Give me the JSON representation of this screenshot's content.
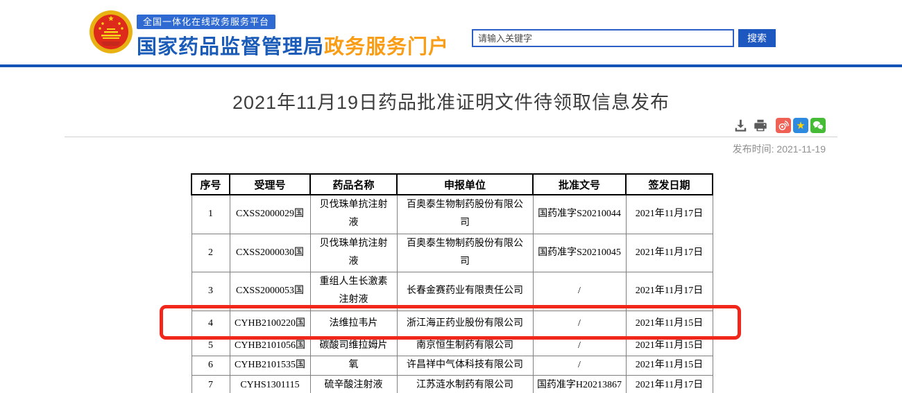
{
  "header": {
    "platform_badge": "全国一体化在线政务服务平台",
    "site_name": "国家药品监督管理局",
    "portal_name": "政务服务门户",
    "search": {
      "placeholder": "请输入关键字",
      "button_label": "搜索"
    }
  },
  "article": {
    "title": "2021年11月19日药品批准证明文件待领取信息发布",
    "publish_label": "发布时间:",
    "publish_date": "2021-11-19",
    "toolbar_icons": [
      "download-icon",
      "print-icon",
      "weibo-share-icon",
      "qzone-share-icon",
      "wechat-share-icon"
    ]
  },
  "table": {
    "headers": [
      "序号",
      "受理号",
      "药品名称",
      "申报单位",
      "批准文号",
      "签发日期"
    ],
    "rows": [
      [
        "1",
        "CXSS2000029国",
        "贝伐珠单抗注射液",
        "百奥泰生物制药股份有限公司",
        "国药准字S20210044",
        "2021年11月17日"
      ],
      [
        "2",
        "CXSS2000030国",
        "贝伐珠单抗注射液",
        "百奥泰生物制药股份有限公司",
        "国药准字S20210045",
        "2021年11月17日"
      ],
      [
        "3",
        "CXSS2000053国",
        "重组人生长激素注射液",
        "长春金赛药业有限责任公司",
        "/",
        "2021年11月17日"
      ],
      [
        "4",
        "CYHB2100220国",
        "法维拉韦片",
        "浙江海正药业股份有限公司",
        "/",
        "2021年11月15日"
      ],
      [
        "5",
        "CYHB2101056国",
        "碳酸司维拉姆片",
        "南京恒生制药有限公司",
        "/",
        "2021年11月15日"
      ],
      [
        "6",
        "CYHB2101535国",
        "氧",
        "许昌祥中气体科技有限公司",
        "/",
        "2021年11月15日"
      ],
      [
        "7",
        "CYHS1301115",
        "硫辛酸注射液",
        "江苏涟水制药有限公司",
        "国药准字H20213867",
        "2021年11月17日"
      ]
    ],
    "highlighted_row": "4"
  },
  "colors": {
    "brand_blue": "#1b5cb8",
    "brand_orange": "#fa9d16",
    "header_rule_blue": "#1553b7",
    "badge_blue": "#2e6ad1",
    "search_button_blue": "#1d57c0",
    "highlight_red": "#f2271c",
    "weibo_red": "#ef6055",
    "qzone_blue": "#2c8ae0",
    "wechat_green": "#46bb36"
  }
}
